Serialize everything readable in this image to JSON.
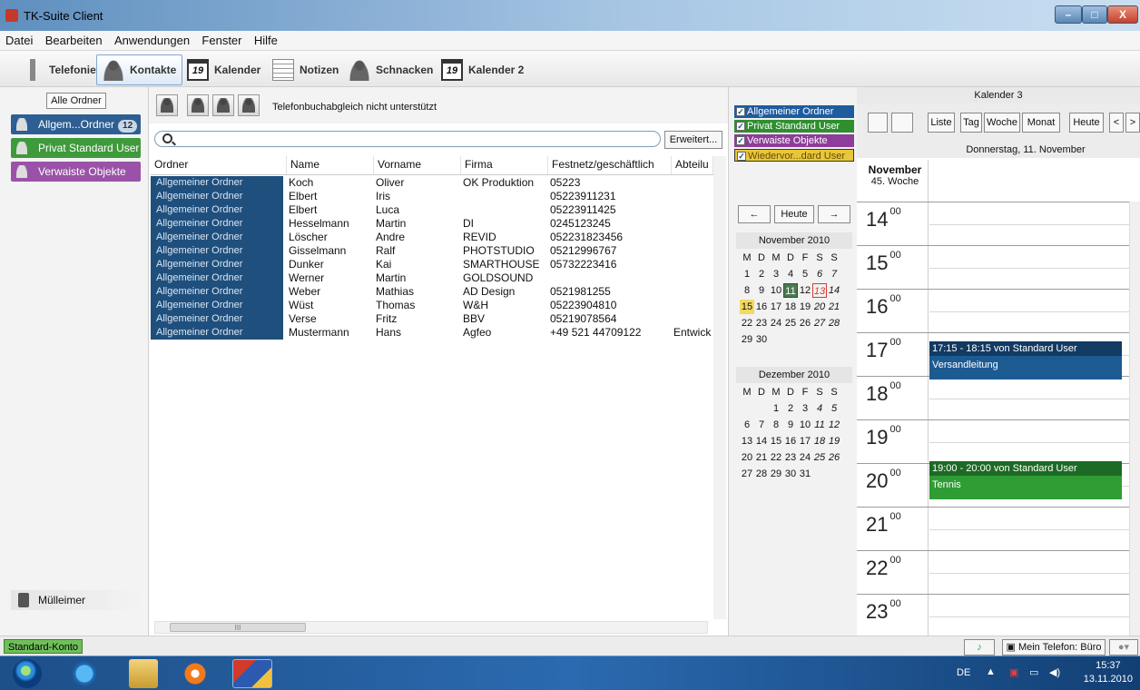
{
  "window": {
    "title": "TK-Suite Client",
    "min": "–",
    "max": "□",
    "close": "X"
  },
  "menu": [
    "Datei",
    "Bearbeiten",
    "Anwendungen",
    "Fenster",
    "Hilfe"
  ],
  "toolbar": {
    "telefonie": "Telefonie",
    "kontakte": "Kontakte",
    "kalender": "Kalender",
    "kalender_icon_num": "19",
    "notizen": "Notizen",
    "schnacken": "Schnacken",
    "kalender2": "Kalender 2"
  },
  "sidebar": {
    "all_folders": "Alle Ordner",
    "folders": [
      {
        "label": "Allgem...Ordner",
        "badge": "12",
        "color": "#2d5f93"
      },
      {
        "label": "Privat Standard User",
        "color": "#3e9a3a"
      },
      {
        "label": "Verwaiste Objekte",
        "color": "#9a52a8"
      }
    ],
    "trash": "Mülleimer"
  },
  "contacts": {
    "sync_text": "Telefonbuchabgleich nicht unterstützt",
    "search_value": "",
    "erweitert": "Erweitert...",
    "columns": [
      "Ordner",
      "Name",
      "Vorname",
      "Firma",
      "Festnetz/geschäftlich",
      "Abteilu"
    ],
    "rows": [
      [
        "Allgemeiner Ordner",
        "Koch",
        "Oliver",
        "OK Produktion",
        "05223",
        ""
      ],
      [
        "Allgemeiner Ordner",
        "Elbert",
        "Iris",
        "",
        "05223911231",
        ""
      ],
      [
        "Allgemeiner Ordner",
        "Elbert",
        "Luca",
        "",
        "05223911425",
        ""
      ],
      [
        "Allgemeiner Ordner",
        "Hesselmann",
        "Martin",
        "DI",
        "0245123245",
        ""
      ],
      [
        "Allgemeiner Ordner",
        "Löscher",
        "Andre",
        "REVID",
        "052231823456",
        ""
      ],
      [
        "Allgemeiner Ordner",
        "Gisselmann",
        "Ralf",
        "PHOTSTUDIO",
        "05212996767",
        ""
      ],
      [
        "Allgemeiner Ordner",
        "Dunker",
        "Kai",
        "SMARTHOUSE",
        "05732223416",
        ""
      ],
      [
        "Allgemeiner Ordner",
        "Werner",
        "Martin",
        "GOLDSOUND",
        "",
        ""
      ],
      [
        "Allgemeiner Ordner",
        " Weber",
        "Mathias",
        "AD Design",
        "0521981255",
        ""
      ],
      [
        "Allgemeiner Ordner",
        "Wüst",
        "Thomas",
        "W&H",
        "05223904810",
        ""
      ],
      [
        "Allgemeiner Ordner",
        "Verse",
        "Fritz",
        "BBV",
        "05219078564",
        ""
      ],
      [
        "Allgemeiner Ordner",
        "Mustermann",
        "Hans",
        "Agfeo",
        "+49 521 44709122",
        "Entwick"
      ]
    ],
    "hscroll_glyph": "III"
  },
  "calendars": [
    {
      "label": "Allgemeiner Ordner",
      "color": "#1f5c9e"
    },
    {
      "label": "Privat Standard User",
      "color": "#2f8f2f"
    },
    {
      "label": "Verwaiste Objekte",
      "color": "#8d3d9a"
    },
    {
      "label": "Wiedervor...dard User",
      "color": "#e8c63b"
    }
  ],
  "minical_nav": {
    "prev": "←",
    "today": "Heute",
    "next": "→"
  },
  "minical": [
    {
      "title": "November 2010",
      "head": [
        "M",
        "D",
        "M",
        "D",
        "F",
        "S",
        "S"
      ],
      "days": [
        "1",
        "2",
        "3",
        "4",
        "5",
        "6",
        "7",
        "8",
        "9",
        "10",
        "11",
        "12",
        "13",
        "14",
        "15",
        "16",
        "17",
        "18",
        "19",
        "20",
        "21",
        "22",
        "23",
        "24",
        "25",
        "26",
        "27",
        "28",
        "29",
        "30"
      ],
      "offset": 0
    },
    {
      "title": "Dezember 2010",
      "head": [
        "M",
        "D",
        "M",
        "D",
        "F",
        "S",
        "S"
      ],
      "days": [
        "1",
        "2",
        "3",
        "4",
        "5",
        "6",
        "7",
        "8",
        "9",
        "10",
        "11",
        "12",
        "13",
        "14",
        "15",
        "16",
        "17",
        "18",
        "19",
        "20",
        "21",
        "22",
        "23",
        "24",
        "25",
        "26",
        "27",
        "28",
        "29",
        "30",
        "31"
      ],
      "offset": 2
    }
  ],
  "dayview": {
    "calendar_title": "Kalender 3",
    "buttons": [
      "Liste",
      "Tag",
      "Woche",
      "Monat",
      "Heute",
      "<",
      ">"
    ],
    "date": "Donnerstag, 11. November",
    "month": "November",
    "week": "45. Woche",
    "hours": [
      "14",
      "15",
      "16",
      "17",
      "18",
      "19",
      "20",
      "21",
      "22",
      "23"
    ],
    "hour_suffix": "00",
    "appointments": [
      {
        "time": "17:15 - 18:15 von Standard User",
        "title": "Versandleitung",
        "head_color": "#123a62",
        "body_color": "#1c5a92"
      },
      {
        "time": "19:00 - 20:00 von Standard User",
        "title": "Tennis",
        "head_color": "#1d6a24",
        "body_color": "#2f9c34"
      }
    ]
  },
  "status": {
    "account": "Standard-Konto",
    "phone": "Mein Telefon: Büro"
  },
  "taskbar": {
    "lang": "DE",
    "time": "15:37",
    "date": "13.11.2010"
  }
}
